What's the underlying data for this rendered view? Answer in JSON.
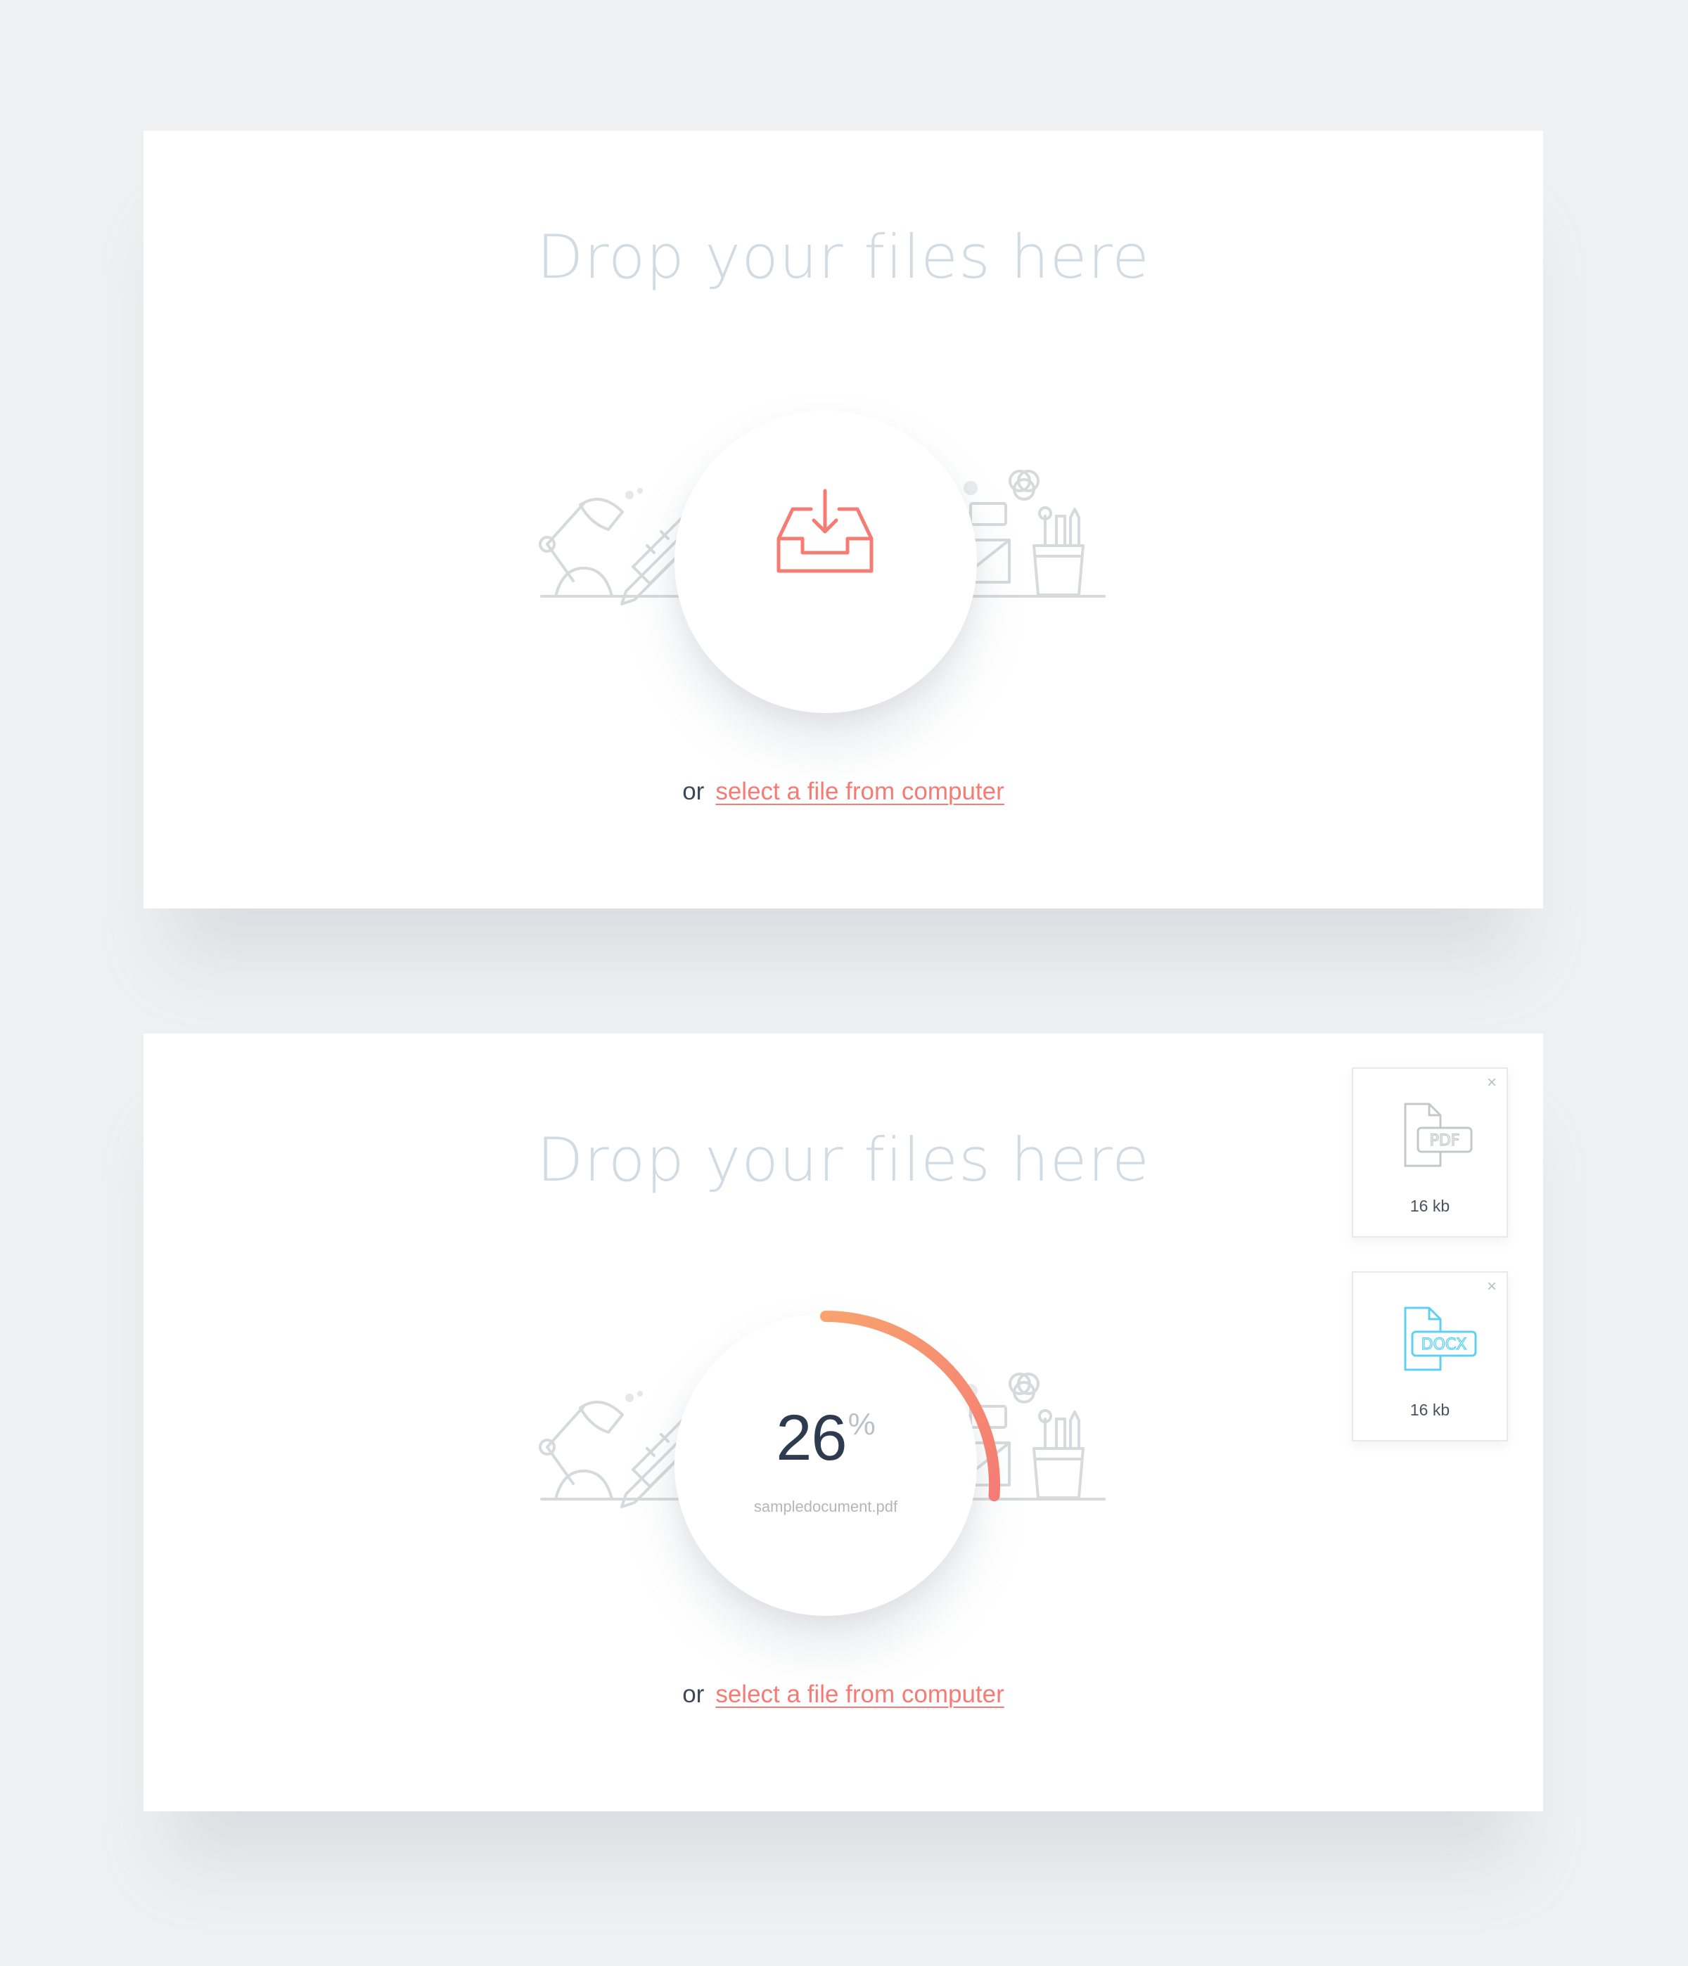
{
  "colors": {
    "page_background": "#eff0f2",
    "panel_background": "#ffffff",
    "title": "#d3dbe2",
    "accent": "#f47c74",
    "progress_start": "#f8a26e",
    "progress_end": "#f47c74",
    "illustration": "#d7d9dc",
    "docx": "#5fd1ee"
  },
  "upload_empty": {
    "title": "Drop your files here",
    "icon": "inbox-download-icon",
    "or_label": "or",
    "select_link": "select a file from computer"
  },
  "upload_progress": {
    "title": "Drop your files here",
    "progress": {
      "value": "26",
      "unit": "%",
      "fraction": 0.26,
      "filename": "sampledocument.pdf"
    },
    "or_label": "or",
    "select_link": "select a file from computer",
    "files": [
      {
        "type": "PDF",
        "size": "16 kb",
        "icon": "pdf-file-icon",
        "close": "×"
      },
      {
        "type": "DOCX",
        "size": "16 kb",
        "icon": "docx-file-icon",
        "close": "×"
      }
    ]
  }
}
